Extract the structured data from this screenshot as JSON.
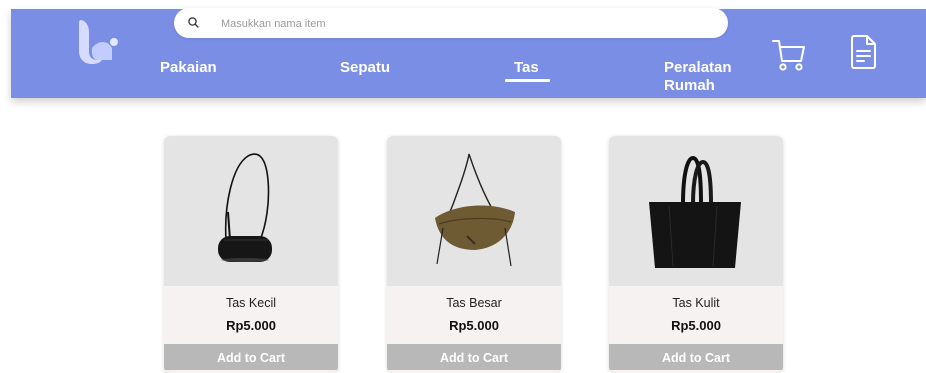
{
  "search": {
    "placeholder": "Masukkan nama item",
    "value": ""
  },
  "nav": {
    "items": [
      {
        "label": "Pakaian"
      },
      {
        "label": "Sepatu"
      },
      {
        "label": "Tas",
        "active": true
      },
      {
        "label": "Peralatan\nRumah"
      }
    ]
  },
  "icons": {
    "logo": "brand-logo",
    "search": "search-icon",
    "cart": "cart-icon",
    "orders": "document-icon"
  },
  "colors": {
    "header": "#7b8ee6",
    "logo": "#c9d2ff",
    "button": "#b8b8b8",
    "card_body": "#f5f2f1"
  },
  "products": [
    {
      "name": "Tas Kecil",
      "price": "Rp5.000",
      "button": "Add to Cart"
    },
    {
      "name": "Tas Besar",
      "price": "Rp5.000",
      "button": "Add to Cart"
    },
    {
      "name": "Tas Kulit",
      "price": "Rp5.000",
      "button": "Add to Cart"
    }
  ]
}
